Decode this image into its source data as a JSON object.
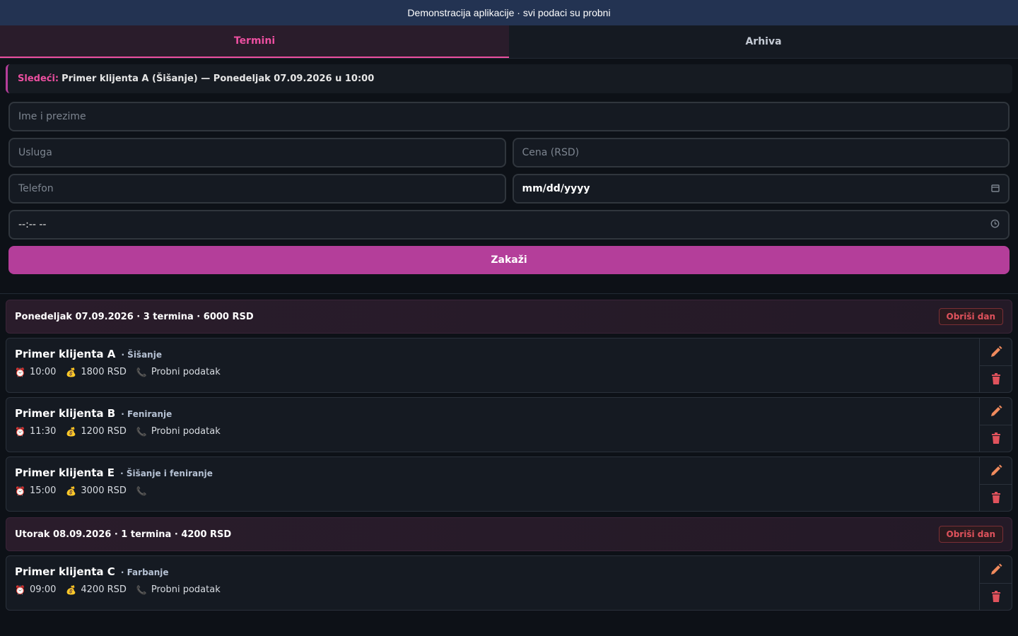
{
  "banner": "Demonstracija aplikacije · svi podaci su probni",
  "tabs": [
    {
      "label": "Termini",
      "active": true
    },
    {
      "label": "Arhiva",
      "active": false
    }
  ],
  "next": {
    "label": "Sledeći:",
    "text": "Primer klijenta A (Šišanje) — Ponedeljak 07.09.2026 u 10:00"
  },
  "form": {
    "name_placeholder": "Ime i prezime",
    "service_placeholder": "Usluga",
    "price_placeholder": "Cena (RSD)",
    "phone_placeholder": "Telefon",
    "date_value": "mm/dd/yyyy",
    "time_value": "--:-- --",
    "submit_label": "Zakaži"
  },
  "colors": {
    "accent": "#ec4fa0",
    "button": "#b43e9a",
    "danger": "#e0525c",
    "edit": "#f08a5d"
  },
  "days": [
    {
      "title": "Ponedeljak 07.09.2026 · 3 termina · 6000 RSD",
      "delete_label": "Obriši dan",
      "appointments": [
        {
          "name": "Primer klijenta A",
          "service": "· Šišanje",
          "time": "10:00",
          "price": "1800 RSD",
          "phone": "Probni podatak"
        },
        {
          "name": "Primer klijenta B",
          "service": "· Feniranje",
          "time": "11:30",
          "price": "1200 RSD",
          "phone": "Probni podatak"
        },
        {
          "name": "Primer klijenta E",
          "service": "· Šišanje i feniranje",
          "time": "15:00",
          "price": "3000 RSD",
          "phone": ""
        }
      ]
    },
    {
      "title": "Utorak 08.09.2026 · 1 termina · 4200 RSD",
      "delete_label": "Obriši dan",
      "appointments": [
        {
          "name": "Primer klijenta C",
          "service": "· Farbanje",
          "time": "09:00",
          "price": "4200 RSD",
          "phone": "Probni podatak"
        }
      ]
    }
  ],
  "icons": {
    "time": "alarm-clock-icon",
    "price": "money-bag-icon",
    "phone": "phone-icon",
    "edit": "pencil-icon",
    "delete": "trash-icon"
  }
}
